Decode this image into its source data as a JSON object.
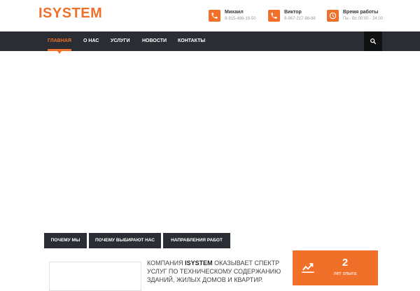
{
  "header": {
    "logo": "ISYSTEM",
    "contacts": [
      {
        "name": "Михаил",
        "detail": "8-915-486-19-50",
        "icon": "phone-icon"
      },
      {
        "name": "Виктор",
        "detail": "8-967-217-98-88",
        "icon": "phone-icon"
      },
      {
        "name": "Время работы",
        "detail": "Пн - Вс 00:00 - 24:00",
        "icon": "clock-icon"
      }
    ]
  },
  "nav": {
    "items": [
      {
        "label": "Главная",
        "active": true
      },
      {
        "label": "О нас"
      },
      {
        "label": "Услуги"
      },
      {
        "label": "Новости"
      },
      {
        "label": "Контакты"
      }
    ],
    "search_icon": "search-icon"
  },
  "tabs": [
    "Почему мы",
    "Почему выбирают нас",
    "Направления работ"
  ],
  "about": {
    "prefix": "Компания",
    "brand": "ISYSTEM",
    "text": "оказывает спектр услуг по техническому содержанию зданий, жилых домов и квартир."
  },
  "stat": {
    "value": "2",
    "label": "лет опыта",
    "icon": "trend-up-icon"
  },
  "colors": {
    "accent": "#f0702a",
    "nav_bg": "#2a2d33",
    "search_bg": "#111214"
  }
}
